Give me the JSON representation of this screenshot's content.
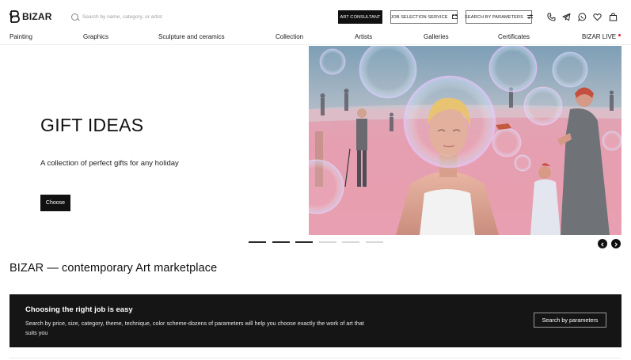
{
  "header": {
    "logo_text": "BIZAR",
    "search_placeholder": "Search by name, category, or artist",
    "art_consultant_label": "ART CONSULTANT",
    "job_selection_label": "JOB SELECTION SERVICE",
    "search_params_label": "SEARCH BY PARAMETERS",
    "icons": [
      "phone-icon",
      "telegram-icon",
      "whatsapp-icon",
      "heart-icon",
      "bag-icon"
    ]
  },
  "nav": {
    "items": [
      "Painting",
      "Graphics",
      "Sculpture and ceramics",
      "Collection",
      "Artists",
      "Galleries",
      "Certificates",
      "BIZAR LIVE"
    ]
  },
  "hero": {
    "title": "GIFT IDEAS",
    "subtitle": "A collection of perfect gifts for any holiday",
    "cta_label": "Choose"
  },
  "slider": {
    "slide_count": 6,
    "active_count": 3
  },
  "section": {
    "title": "BIZAR — contemporary Art marketplace"
  },
  "promo": {
    "heading": "Choosing the right job is easy",
    "text": "Search by price, size, category, theme, technique, color scheme-dozens of parameters will help you choose exactly the work of art that suits you",
    "button_label": "Search by parameters"
  },
  "colors": {
    "accent_dark": "#111111",
    "live_dot": "#e2233a",
    "banner_bg": "#151515",
    "art_ground": "#e9a6b4"
  }
}
